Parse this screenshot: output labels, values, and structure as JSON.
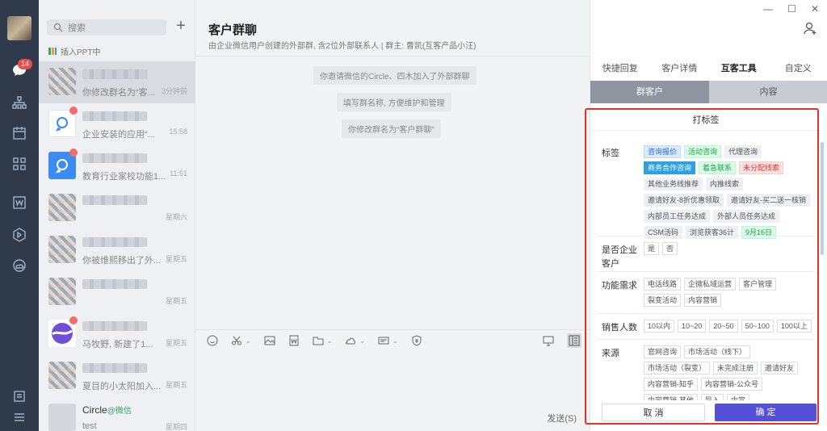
{
  "rail": {
    "badge": "14"
  },
  "search": {
    "placeholder": "搜索"
  },
  "ppt_status": "插入PPT中",
  "chats": [
    {
      "preview": "你修改群名为“客...",
      "time": "3分钟前",
      "avatar": "mosaic",
      "selected": true
    },
    {
      "preview": "企业安装的应用“...",
      "time": "15:58",
      "avatar": "white",
      "dot": true
    },
    {
      "preview": "教育行业家校功能1...",
      "time": "11:51",
      "avatar": "blue",
      "dot": true
    },
    {
      "preview": "",
      "time": "星期六",
      "avatar": "mosaic"
    },
    {
      "preview": "你被维熙移出了外...",
      "time": "星期五",
      "avatar": "mosaic"
    },
    {
      "preview": "",
      "time": "星期五",
      "avatar": "mosaic"
    },
    {
      "preview": "马牧野, 新建了1...",
      "time": "星期五",
      "avatar": "purple",
      "dot": true
    },
    {
      "preview": "夏目的小太阳加入...",
      "time": "星期五",
      "avatar": "mosaic"
    },
    {
      "name": "Circle",
      "name_tag": "@微信",
      "preview": "test",
      "time": "星期四",
      "avatar": "grey"
    }
  ],
  "main": {
    "title": "客户群聊",
    "subtitle": "由企业微信用户创建的外部群, 含2位外部联系人  | 群主: 曹凯(互客产品小汪)",
    "system_messages": [
      "你邀请微信的Circle、四木加入了外部群聊",
      "填写群名称, 方便维护和管理",
      "你修改群名为“客户群聊”"
    ],
    "send_label": "发送(S)"
  },
  "right": {
    "tabs": [
      "快捷回复",
      "客户详情",
      "互客工具",
      "自定义"
    ],
    "active_tab": 2,
    "subtabs": [
      "群客户",
      "内容"
    ],
    "panel_title": "打标签",
    "groups": [
      {
        "label": "标签",
        "chips": [
          {
            "t": "咨询报价",
            "s": "c-blue"
          },
          {
            "t": "活动咨询",
            "s": "c-green"
          },
          {
            "t": "代理咨询",
            "s": "c-grey"
          },
          {
            "t": "商务合作咨询",
            "s": "c-solid"
          },
          {
            "t": "着急联系",
            "s": "c-green"
          },
          {
            "t": "未分配线索",
            "s": "c-red"
          },
          {
            "t": "其他业务线推荐",
            "s": "c-grey"
          },
          {
            "t": "内推线索",
            "s": "c-grey"
          },
          {
            "t": "邀请好友-8折优惠领取",
            "s": "c-grey"
          },
          {
            "t": "邀请好友-买二送一核销",
            "s": "c-grey"
          },
          {
            "t": "内部员工任务达成",
            "s": "c-grey"
          },
          {
            "t": "外部人员任务达成",
            "s": "c-grey"
          },
          {
            "t": "CSM活码",
            "s": "c-grey"
          },
          {
            "t": "浏览获客36计",
            "s": "c-grey"
          },
          {
            "t": "9月16日",
            "s": "c-green"
          }
        ]
      },
      {
        "label": "是否企业客户",
        "chips": [
          {
            "t": "是",
            "s": ""
          },
          {
            "t": "否",
            "s": ""
          }
        ]
      },
      {
        "label": "功能需求",
        "chips": [
          {
            "t": "电话线路",
            "s": ""
          },
          {
            "t": "企微私域运营",
            "s": ""
          },
          {
            "t": "客户管理",
            "s": ""
          },
          {
            "t": "裂变活动",
            "s": ""
          },
          {
            "t": "内容营销",
            "s": ""
          }
        ]
      },
      {
        "label": "销售人数",
        "chips": [
          {
            "t": "10以内",
            "s": ""
          },
          {
            "t": "10~20",
            "s": ""
          },
          {
            "t": "20~50",
            "s": ""
          },
          {
            "t": "50~100",
            "s": ""
          },
          {
            "t": "100以上",
            "s": ""
          }
        ]
      },
      {
        "label": "来源",
        "chips": [
          {
            "t": "官网咨询",
            "s": ""
          },
          {
            "t": "市场活动（线下）",
            "s": ""
          },
          {
            "t": "市场活动（裂变）",
            "s": ""
          },
          {
            "t": "未完成注册",
            "s": ""
          },
          {
            "t": "邀请好友",
            "s": ""
          },
          {
            "t": "内容营销-知乎",
            "s": ""
          },
          {
            "t": "内容营销-公众号",
            "s": ""
          },
          {
            "t": "内容营销-其他",
            "s": ""
          },
          {
            "t": "导入",
            "s": ""
          },
          {
            "t": "内宣",
            "s": ""
          }
        ]
      }
    ],
    "cancel_label": "取 消",
    "ok_label": "确 定"
  }
}
